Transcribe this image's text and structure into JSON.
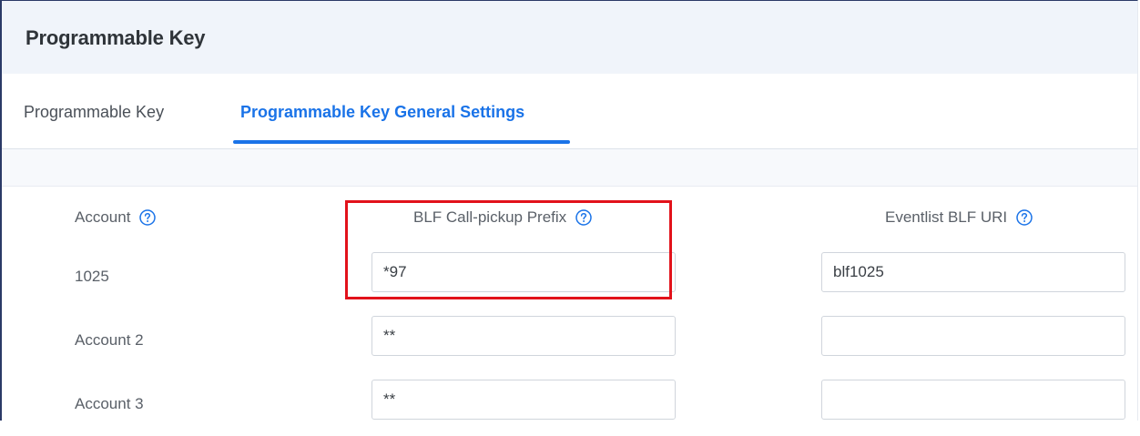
{
  "page": {
    "title": "Programmable Key"
  },
  "tabs": [
    {
      "label": "Programmable Key",
      "active": false
    },
    {
      "label": "Programmable Key General Settings",
      "active": true
    }
  ],
  "columns": {
    "account": "Account",
    "prefix": "BLF Call-pickup Prefix",
    "uri": "Eventlist BLF URI"
  },
  "rows": [
    {
      "account": "1025",
      "prefix": "*97",
      "uri": "blf1025"
    },
    {
      "account": "Account 2",
      "prefix": "**",
      "uri": ""
    },
    {
      "account": "Account 3",
      "prefix": "**",
      "uri": ""
    }
  ],
  "colors": {
    "accent": "#1a73e8",
    "highlight": "#e2121b",
    "header_bg": "#f0f4fa"
  },
  "icons": {
    "help": "help-circle-icon"
  }
}
